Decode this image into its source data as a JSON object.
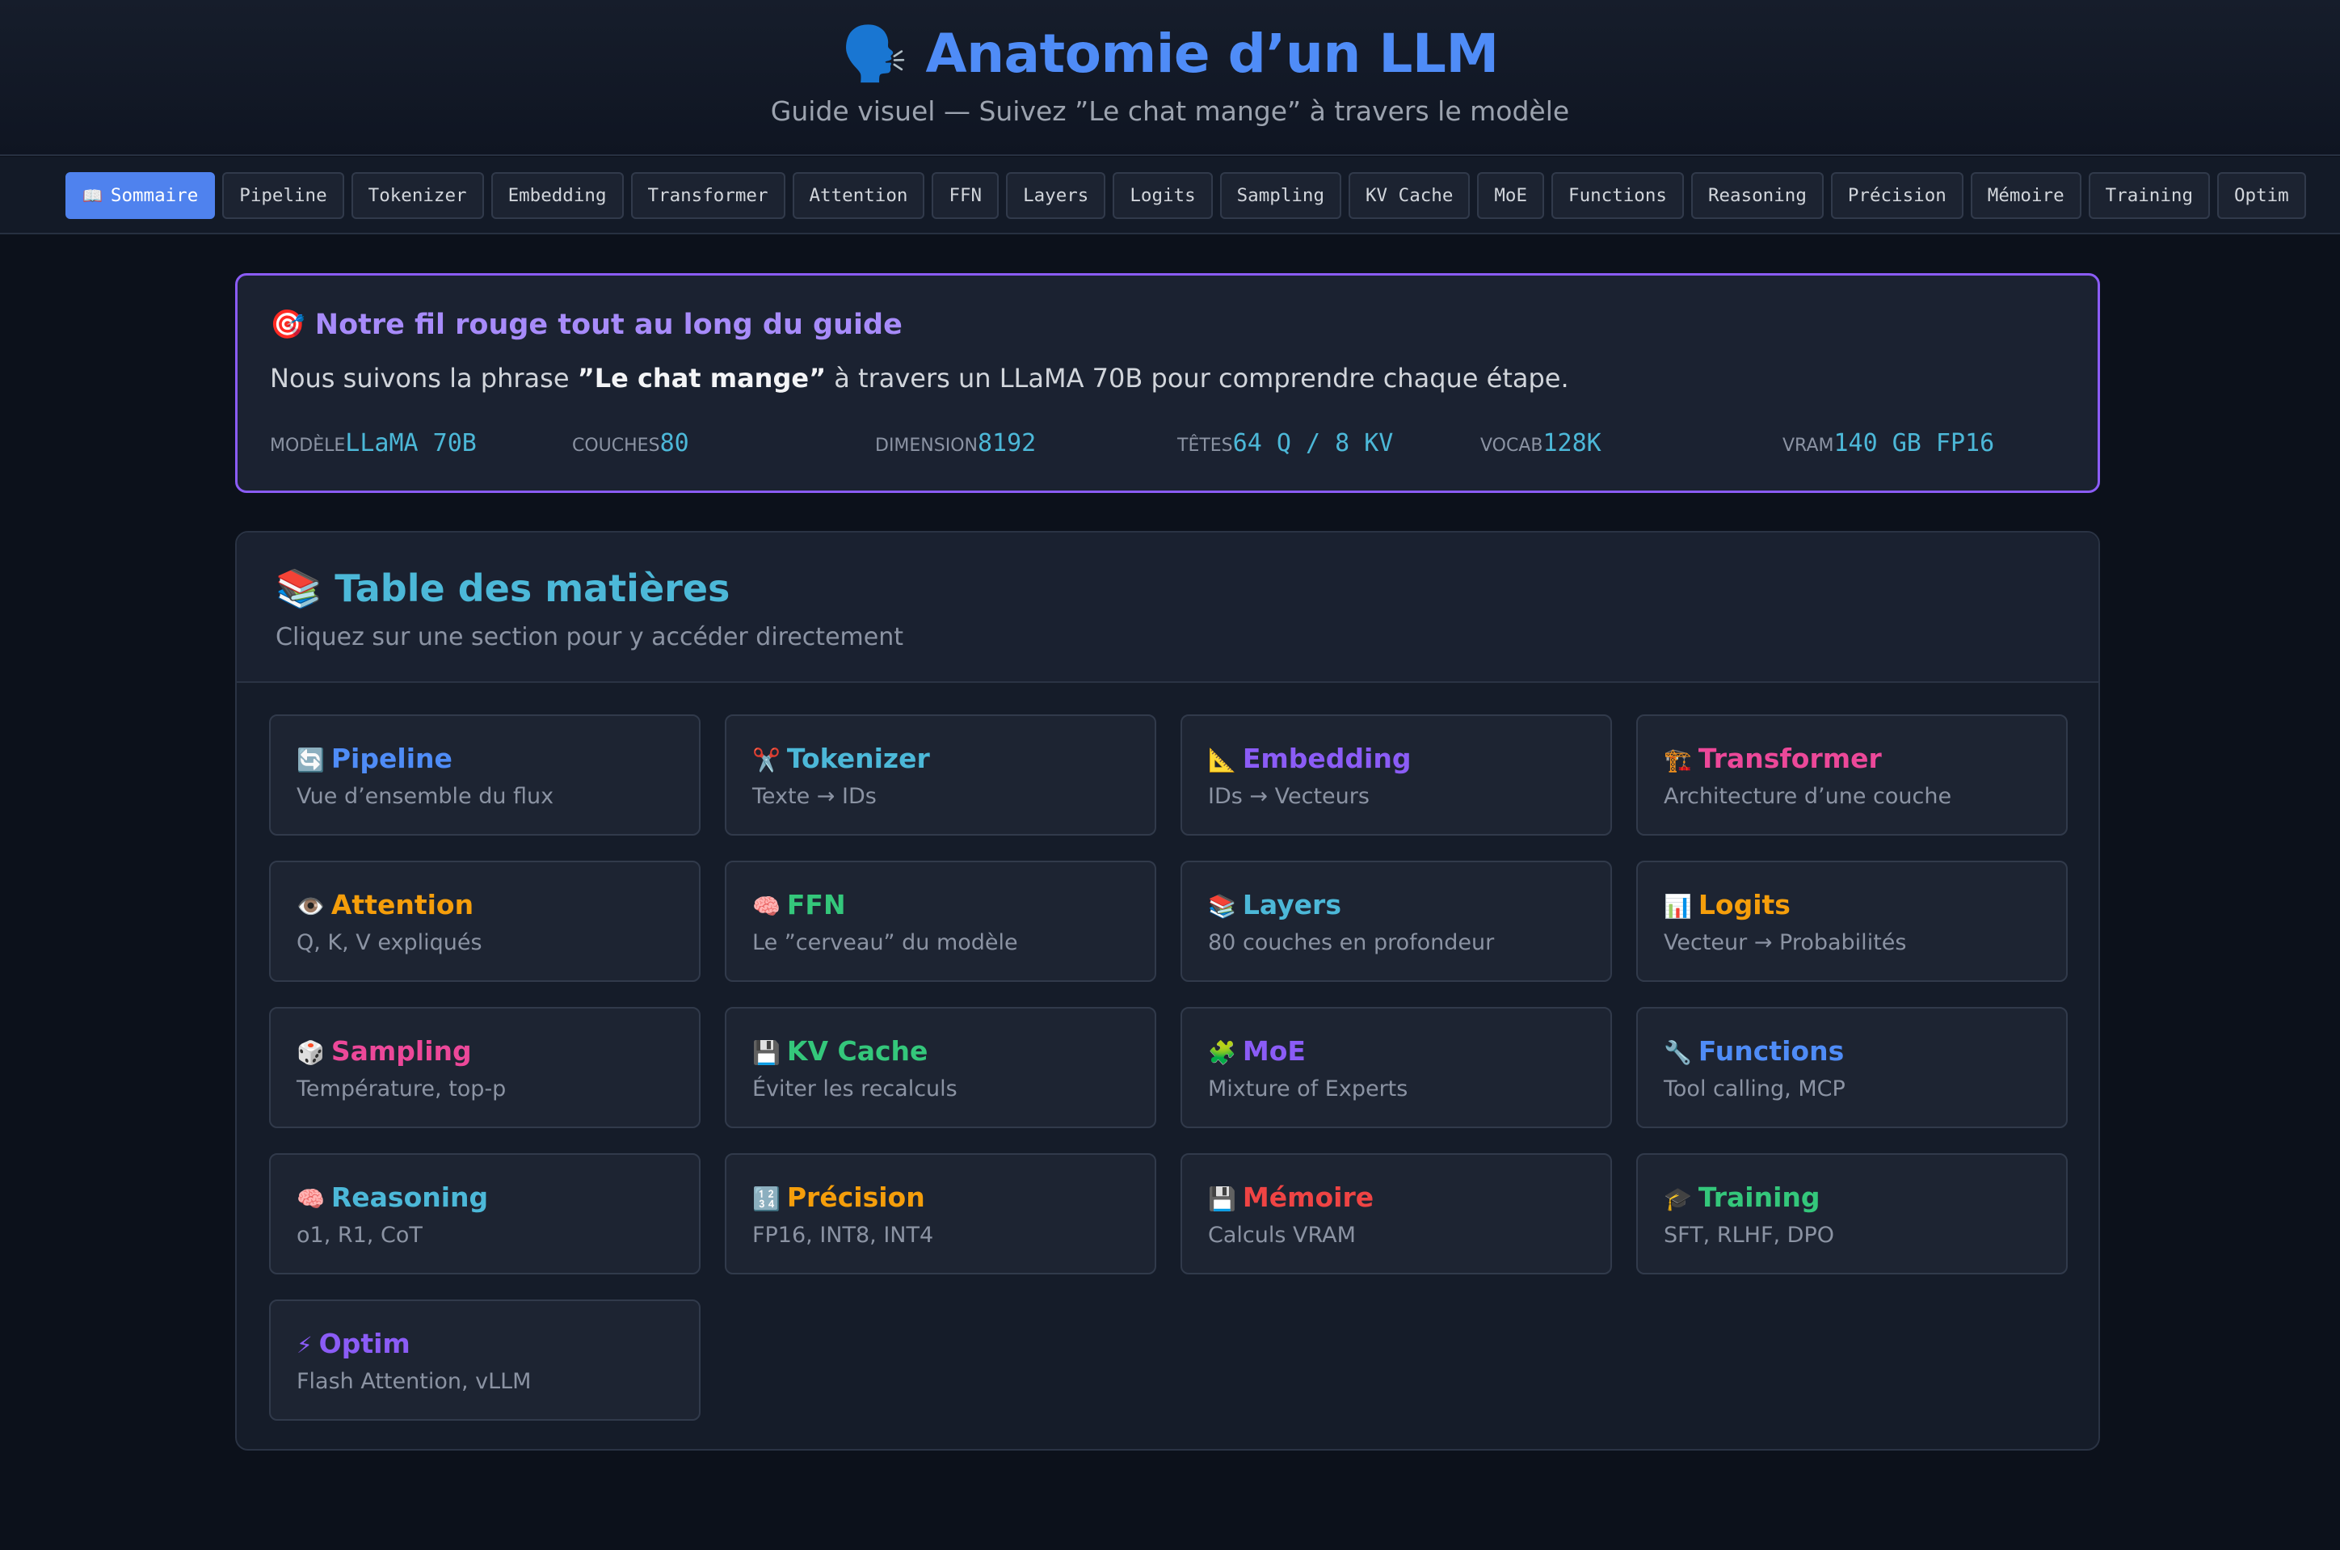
{
  "header": {
    "title": "Anatomie d’un LLM",
    "title_icon": "🗣️",
    "subtitle": "Guide visuel — Suivez ”Le chat mange” à travers le modèle"
  },
  "nav": {
    "items": [
      {
        "label": "Sommaire",
        "icon": "📖",
        "active": true
      },
      {
        "label": "Pipeline"
      },
      {
        "label": "Tokenizer"
      },
      {
        "label": "Embedding"
      },
      {
        "label": "Transformer"
      },
      {
        "label": "Attention"
      },
      {
        "label": "FFN"
      },
      {
        "label": "Layers"
      },
      {
        "label": "Logits"
      },
      {
        "label": "Sampling"
      },
      {
        "label": "KV Cache"
      },
      {
        "label": "MoE"
      },
      {
        "label": "Functions"
      },
      {
        "label": "Reasoning"
      },
      {
        "label": "Précision"
      },
      {
        "label": "Mémoire"
      },
      {
        "label": "Training"
      },
      {
        "label": "Optim"
      }
    ]
  },
  "fil_rouge": {
    "icon": "🎯",
    "title": "Notre fil rouge tout au long du guide",
    "text_before": "Nous suivons la phrase ",
    "text_bold": "”Le chat mange”",
    "text_after": " à travers un LLaMA 70B pour comprendre chaque étape.",
    "stats": [
      {
        "label": "Modèle",
        "value": "LLaMA 70B"
      },
      {
        "label": "Couches",
        "value": "80"
      },
      {
        "label": "Dimension",
        "value": "8192"
      },
      {
        "label": "Têtes",
        "value": "64 Q / 8 KV"
      },
      {
        "label": "Vocab",
        "value": "128K"
      },
      {
        "label": "VRAM",
        "value": "140 GB FP16"
      }
    ]
  },
  "toc": {
    "icon": "📚",
    "title": "Table des matières",
    "subtitle": "Cliquez sur une section pour y accéder directement",
    "cards": [
      {
        "icon": "🔄",
        "title": "Pipeline",
        "desc": "Vue d’ensemble du flux",
        "color": "#4f8cf7"
      },
      {
        "icon": "✂️",
        "title": "Tokenizer",
        "desc": "Texte → IDs",
        "color": "#4cb8d8"
      },
      {
        "icon": "📐",
        "title": "Embedding",
        "desc": "IDs → Vecteurs",
        "color": "#8b5cf6"
      },
      {
        "icon": "🏗️",
        "title": "Transformer",
        "desc": "Architecture d’une couche",
        "color": "#ec4899"
      },
      {
        "icon": "👁️",
        "title": "Attention",
        "desc": "Q, K, V expliqués",
        "color": "#f59e0b"
      },
      {
        "icon": "🧠",
        "title": "FFN",
        "desc": "Le ”cerveau” du modèle",
        "color": "#34c77b"
      },
      {
        "icon": "📚",
        "title": "Layers",
        "desc": "80 couches en profondeur",
        "color": "#4cb8d8"
      },
      {
        "icon": "📊",
        "title": "Logits",
        "desc": "Vecteur → Probabilités",
        "color": "#f59e0b"
      },
      {
        "icon": "🎲",
        "title": "Sampling",
        "desc": "Température, top-p",
        "color": "#ec4899"
      },
      {
        "icon": "💾",
        "title": "KV Cache",
        "desc": "Éviter les recalculs",
        "color": "#34c77b"
      },
      {
        "icon": "🧩",
        "title": "MoE",
        "desc": "Mixture of Experts",
        "color": "#8b5cf6"
      },
      {
        "icon": "🔧",
        "title": "Functions",
        "desc": "Tool calling, MCP",
        "color": "#4f8cf7"
      },
      {
        "icon": "🧠",
        "title": "Reasoning",
        "desc": "o1, R1, CoT",
        "color": "#4cb8d8"
      },
      {
        "icon": "🔢",
        "title": "Précision",
        "desc": "FP16, INT8, INT4",
        "color": "#f59e0b"
      },
      {
        "icon": "💾",
        "title": "Mémoire",
        "desc": "Calculs VRAM",
        "color": "#ef4444"
      },
      {
        "icon": "🎓",
        "title": "Training",
        "desc": "SFT, RLHF, DPO",
        "color": "#34c77b"
      },
      {
        "icon": "⚡",
        "title": "Optim",
        "desc": "Flash Attention, vLLM",
        "color": "#8b5cf6"
      }
    ]
  }
}
